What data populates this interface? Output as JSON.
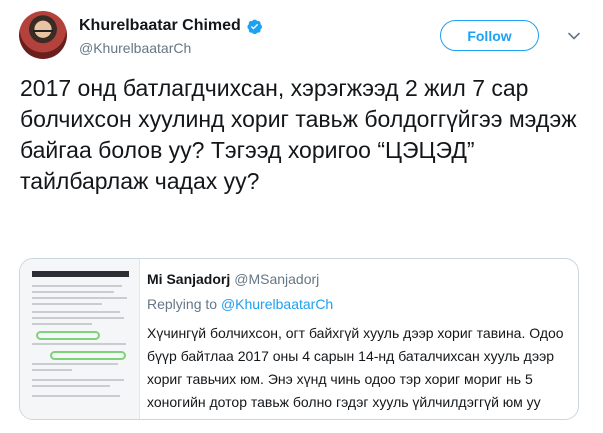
{
  "author": {
    "name": "Khurelbaatar Chimed",
    "handle": "@KhurelbaatarCh",
    "verified": true
  },
  "header": {
    "follow_label": "Follow",
    "more_icon": "chevron-down-icon"
  },
  "tweet": {
    "text": "2017 онд батлагдчихсан, хэрэгжээд 2 жил 7 сар болчихсон хуулинд хориг тавьж болдоггүйгээ мэдэж байгаа болов уу? Тэгээд хоригоо “ЦЭЦЭД” тайлбарлаж чадах уу?"
  },
  "quoted_tweet": {
    "name": "Mi Sanjadorj",
    "handle": "@MSanjadorj",
    "replying_prefix": "Replying to",
    "replying_handle": "@KhurelbaatarCh",
    "text": "Хүчингүй болчихсон, огт байхгүй хууль дээр хориг тавина. Одоо бүүр байтлаа 2017 оны 4 сарын 14-нд баталчихсан хууль дээр хориг тавьчих юм. Энэ хүнд чинь одоо тэр хориг мориг нь 5 хоногийн дотор тавьж болно гэдэг хууль үйлчилдэггүй юм уу"
  },
  "colors": {
    "accent": "#1da1f2",
    "text": "#14171a",
    "muted": "#657786",
    "border": "#ccd6dd"
  }
}
